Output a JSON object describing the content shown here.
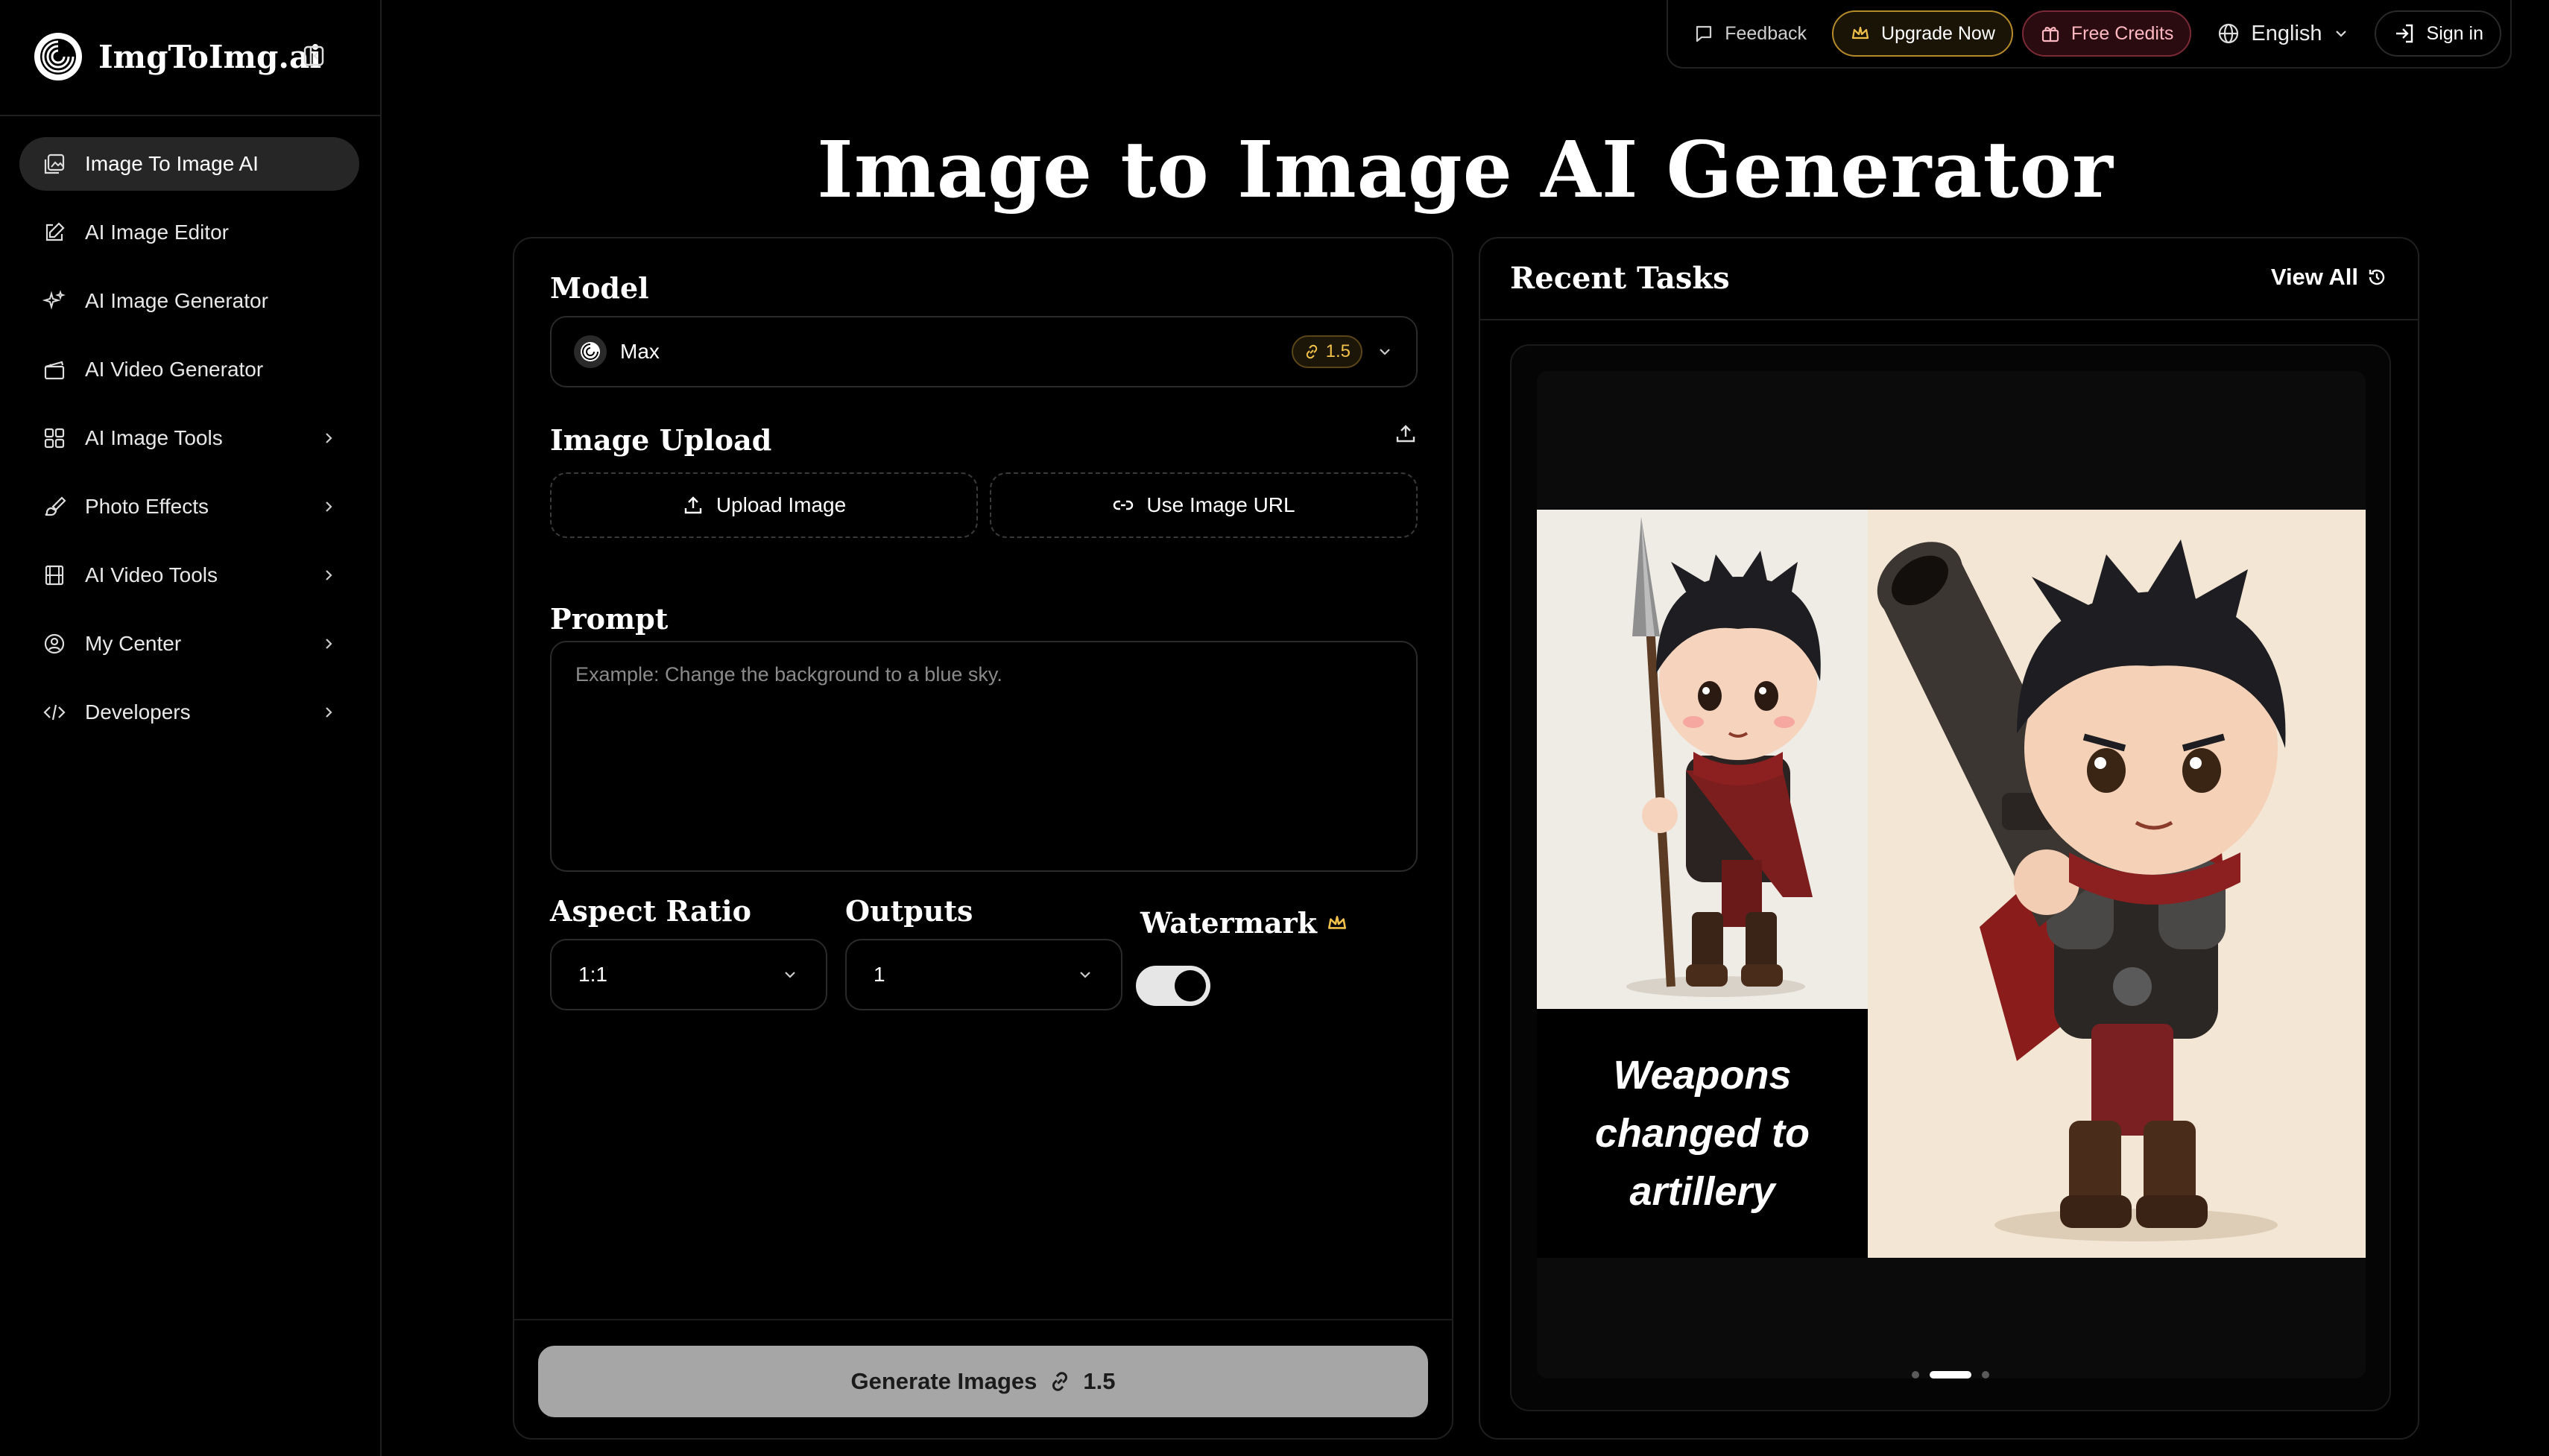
{
  "brand": {
    "name": "ImgToImg.ai"
  },
  "sidebar": {
    "items": [
      {
        "label": "Image To Image AI",
        "icon": "image-edit-icon",
        "active": true,
        "has_submenu": false
      },
      {
        "label": "AI Image Editor",
        "icon": "pencil-square-icon",
        "active": false,
        "has_submenu": false
      },
      {
        "label": "AI Image Generator",
        "icon": "sparkles-icon",
        "active": false,
        "has_submenu": false
      },
      {
        "label": "AI Video Generator",
        "icon": "clapperboard-icon",
        "active": false,
        "has_submenu": false
      },
      {
        "label": "AI Image Tools",
        "icon": "grid-icon",
        "active": false,
        "has_submenu": true
      },
      {
        "label": "Photo Effects",
        "icon": "brush-icon",
        "active": false,
        "has_submenu": true
      },
      {
        "label": "AI Video Tools",
        "icon": "film-icon",
        "active": false,
        "has_submenu": true
      },
      {
        "label": "My Center",
        "icon": "user-circle-icon",
        "active": false,
        "has_submenu": true
      },
      {
        "label": "Developers",
        "icon": "code-icon",
        "active": false,
        "has_submenu": true
      }
    ]
  },
  "topbar": {
    "feedback": "Feedback",
    "upgrade": "Upgrade Now",
    "free_credits": "Free Credits",
    "language": "English",
    "sign_in": "Sign in"
  },
  "page": {
    "title": "Image to Image AI Generator"
  },
  "form": {
    "model_label": "Model",
    "model_value": "Max",
    "model_cost": "1.5",
    "upload_label": "Image Upload",
    "upload_button": "Upload Image",
    "url_button": "Use Image URL",
    "prompt_label": "Prompt",
    "prompt_placeholder": "Example: Change the background to a blue sky.",
    "aspect_label": "Aspect Ratio",
    "aspect_value": "1:1",
    "outputs_label": "Outputs",
    "outputs_value": "1",
    "watermark_label": "Watermark",
    "watermark_on": true,
    "generate_label": "Generate Images",
    "generate_cost": "1.5"
  },
  "recent": {
    "title": "Recent Tasks",
    "view_all": "View All",
    "caption": "Weapons changed to artillery",
    "slide_count": 3,
    "active_slide": 2
  },
  "colors": {
    "accent_gold": "#f2c14a",
    "free_credits_pink": "#ffb7c1",
    "generate_disabled": "#a6a6a6"
  }
}
